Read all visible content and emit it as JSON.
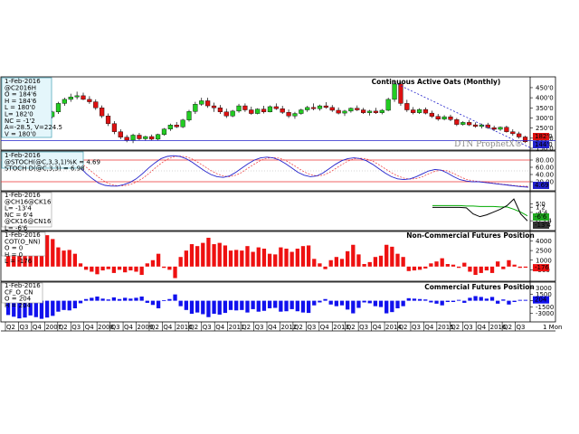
{
  "chart_data": {
    "type": "multi-panel",
    "watermark": "DTN ProphetX®",
    "x_axis": {
      "labels": [
        "Q2",
        "Q3",
        "Q4",
        "2007",
        "Q2",
        "Q3",
        "Q4",
        "2008",
        "Q3",
        "Q4",
        "2009",
        "Q2",
        "Q4",
        "2010",
        "Q2",
        "Q3",
        "Q4",
        "2011",
        "Q2",
        "Q3",
        "Q4",
        "2012",
        "Q2",
        "Q3",
        "Q4",
        "2013",
        "Q2",
        "Q3",
        "Q4",
        "2014",
        "Q2",
        "Q3",
        "Q4",
        "2015",
        "Q2",
        "Q3",
        "Q4",
        "2016",
        "Q2",
        "Q3"
      ],
      "end_label": "1 Mon"
    },
    "panels": [
      {
        "id": "price",
        "title": "Continuous Active Oats (Monthly)",
        "type": "candlestick",
        "info": [
          "1-Feb-2016",
          "@C2016H",
          "O = 184'6",
          "H = 184'6",
          "L = 180'0",
          "L= 182'0",
          "NC = -1'2",
          "A=-28.5, V=224.5",
          "V = 180'0"
        ],
        "y_ticks": [
          "450'0",
          "400'0",
          "350'0",
          "300'0",
          "250'0",
          "200'0",
          "150'0"
        ],
        "ylim": [
          150,
          490
        ],
        "last_labels": [
          "182'0",
          "144'0"
        ],
        "candles": [
          [
            270,
            285,
            258,
            282
          ],
          [
            282,
            295,
            270,
            276
          ],
          [
            276,
            290,
            268,
            285
          ],
          [
            285,
            300,
            275,
            290
          ],
          [
            290,
            305,
            280,
            286
          ],
          [
            286,
            296,
            276,
            292
          ],
          [
            292,
            310,
            284,
            306
          ],
          [
            306,
            335,
            298,
            330
          ],
          [
            330,
            380,
            320,
            372
          ],
          [
            372,
            400,
            360,
            392
          ],
          [
            392,
            420,
            380,
            404
          ],
          [
            404,
            430,
            392,
            410
          ],
          [
            410,
            425,
            388,
            392
          ],
          [
            392,
            408,
            370,
            380
          ],
          [
            380,
            392,
            340,
            350
          ],
          [
            350,
            362,
            300,
            310
          ],
          [
            310,
            322,
            260,
            272
          ],
          [
            272,
            284,
            220,
            232
          ],
          [
            232,
            244,
            195,
            205
          ],
          [
            205,
            216,
            180,
            190
          ],
          [
            190,
            222,
            176,
            215
          ],
          [
            215,
            226,
            190,
            197
          ],
          [
            197,
            212,
            188,
            208
          ],
          [
            208,
            218,
            190,
            195
          ],
          [
            195,
            222,
            190,
            218
          ],
          [
            218,
            250,
            212,
            245
          ],
          [
            245,
            272,
            236,
            265
          ],
          [
            265,
            280,
            250,
            256
          ],
          [
            256,
            296,
            250,
            290
          ],
          [
            290,
            340,
            282,
            332
          ],
          [
            332,
            380,
            320,
            368
          ],
          [
            368,
            400,
            360,
            385
          ],
          [
            385,
            400,
            350,
            360
          ],
          [
            360,
            376,
            330,
            350
          ],
          [
            350,
            364,
            320,
            330
          ],
          [
            330,
            346,
            300,
            310
          ],
          [
            310,
            340,
            304,
            334
          ],
          [
            334,
            370,
            326,
            360
          ],
          [
            360,
            372,
            330,
            340
          ],
          [
            340,
            356,
            316,
            322
          ],
          [
            322,
            348,
            318,
            344
          ],
          [
            344,
            360,
            322,
            330
          ],
          [
            330,
            362,
            328,
            356
          ],
          [
            356,
            372,
            340,
            346
          ],
          [
            346,
            360,
            320,
            328
          ],
          [
            328,
            342,
            300,
            310
          ],
          [
            310,
            330,
            296,
            322
          ],
          [
            322,
            346,
            316,
            340
          ],
          [
            340,
            360,
            330,
            352
          ],
          [
            352,
            372,
            338,
            346
          ],
          [
            346,
            366,
            336,
            360
          ],
          [
            360,
            378,
            346,
            352
          ],
          [
            352,
            364,
            330,
            338
          ],
          [
            338,
            352,
            318,
            324
          ],
          [
            324,
            340,
            310,
            334
          ],
          [
            334,
            352,
            326,
            348
          ],
          [
            348,
            362,
            334,
            340
          ],
          [
            340,
            350,
            320,
            326
          ],
          [
            326,
            340,
            312,
            334
          ],
          [
            334,
            350,
            320,
            326
          ],
          [
            326,
            344,
            318,
            338
          ],
          [
            338,
            400,
            334,
            392
          ],
          [
            392,
            486,
            380,
            468
          ],
          [
            468,
            478,
            360,
            372
          ],
          [
            372,
            390,
            330,
            340
          ],
          [
            340,
            354,
            318,
            326
          ],
          [
            326,
            348,
            320,
            342
          ],
          [
            342,
            352,
            318,
            324
          ],
          [
            324,
            336,
            300,
            308
          ],
          [
            308,
            320,
            286,
            294
          ],
          [
            294,
            314,
            288,
            306
          ],
          [
            306,
            316,
            284,
            292
          ],
          [
            292,
            300,
            260,
            268
          ],
          [
            268,
            284,
            262,
            278
          ],
          [
            278,
            290,
            260,
            266
          ],
          [
            266,
            278,
            252,
            258
          ],
          [
            258,
            272,
            248,
            266
          ],
          [
            266,
            276,
            246,
            252
          ],
          [
            252,
            262,
            236,
            244
          ],
          [
            244,
            258,
            236,
            254
          ],
          [
            254,
            262,
            228,
            232
          ],
          [
            232,
            244,
            212,
            222
          ],
          [
            222,
            232,
            198,
            206
          ],
          [
            206,
            212,
            176,
            182
          ]
        ],
        "support_line": 188,
        "trend_line": [
          [
            62,
            474
          ],
          [
            84,
            150
          ]
        ]
      },
      {
        "id": "stochastic",
        "info": [
          "1-Feb-2016",
          "@STOCH(@C,3,3,1)%K = 4.69",
          "STOCH D(@C,3,3) = 6.98"
        ],
        "y_ticks": [
          "80.00",
          "60.00",
          "40.00",
          "20.00"
        ],
        "ylim": [
          0,
          100
        ],
        "last_label": "4.69",
        "levels": [
          80,
          20
        ],
        "k": [
          62,
          66,
          72,
          80,
          86,
          90,
          92,
          94,
          94,
          92,
          88,
          76,
          60,
          42,
          28,
          16,
          10,
          8,
          8,
          12,
          18,
          28,
          42,
          58,
          72,
          84,
          90,
          92,
          90,
          84,
          74,
          62,
          50,
          40,
          34,
          32,
          36,
          46,
          58,
          70,
          80,
          86,
          88,
          86,
          80,
          70,
          58,
          46,
          38,
          34,
          36,
          44,
          56,
          68,
          78,
          84,
          86,
          84,
          78,
          68,
          56,
          44,
          34,
          28,
          26,
          28,
          34,
          42,
          50,
          54,
          52,
          44,
          34,
          26,
          22,
          20,
          20,
          18,
          16,
          14,
          12,
          10,
          8,
          6,
          5
        ],
        "d": [
          58,
          62,
          68,
          74,
          80,
          86,
          89,
          91,
          92,
          92,
          90,
          84,
          74,
          60,
          46,
          32,
          20,
          12,
          9,
          9,
          12,
          19,
          29,
          42,
          57,
          71,
          82,
          89,
          91,
          89,
          83,
          73,
          62,
          51,
          42,
          36,
          34,
          38,
          46,
          58,
          69,
          79,
          85,
          87,
          85,
          79,
          69,
          58,
          47,
          40,
          36,
          38,
          45,
          56,
          67,
          77,
          83,
          85,
          83,
          77,
          67,
          56,
          45,
          36,
          30,
          27,
          29,
          34,
          42,
          49,
          52,
          50,
          43,
          34,
          27,
          23,
          21,
          19,
          17,
          15,
          13,
          11,
          9,
          8,
          7
        ]
      },
      {
        "id": "spread",
        "info": [
          "1-Feb-2016",
          "@CH16@CK16",
          "L= -13'4",
          "NC = 6'4",
          "@CK16@CN16",
          "L= -6'6"
        ],
        "y_ticks": [
          "1'2",
          "5'0",
          "-4'4",
          "-13'4"
        ],
        "ylim": [
          -22,
          16
        ],
        "last_labels": [
          "-6'6",
          "-13'4"
        ],
        "series": [
          {
            "color": "#00aa00",
            "values": [
              3,
              3,
              3,
              3,
              3,
              2.5,
              2.5,
              2,
              2,
              2,
              1.5,
              1.5,
              -1,
              -4,
              -8
            ]
          },
          {
            "color": "#000000",
            "values": [
              1,
              1,
              1,
              1,
              1,
              0.5,
              -6,
              -9,
              -7,
              -4,
              -1,
              3,
              10,
              -6,
              -13.5
            ]
          }
        ]
      },
      {
        "id": "non-commercial",
        "title": "Non-Commercial Futures Position",
        "info": [
          "1-Feb-2016",
          "COT(O_NN)",
          "O = 0",
          "H = 0",
          "L = -176"
        ],
        "y_ticks": [
          "4000",
          "2500",
          "1000",
          "-500"
        ],
        "ylim": [
          -2000,
          5200
        ],
        "last_label": "-176",
        "values": [
          4200,
          5000,
          5000,
          5000,
          4500,
          4800,
          5000,
          4900,
          4300,
          3000,
          2500,
          2600,
          2000,
          500,
          -500,
          -800,
          -1200,
          -600,
          -400,
          -1000,
          -500,
          -900,
          -600,
          -800,
          -1300,
          500,
          1000,
          2000,
          -200,
          -500,
          -1800,
          1500,
          2500,
          3500,
          3200,
          3700,
          4500,
          3500,
          3700,
          3300,
          2500,
          2600,
          2500,
          3200,
          2300,
          3000,
          2800,
          2000,
          1900,
          3000,
          2800,
          2300,
          2800,
          3200,
          3300,
          1200,
          500,
          -400,
          1000,
          1500,
          1200,
          2400,
          3400,
          1900,
          400,
          700,
          1500,
          1700,
          3400,
          3100,
          2000,
          1500,
          -700,
          -600,
          -500,
          -300,
          500,
          800,
          1300,
          400,
          300,
          -200,
          600,
          -800,
          -1300,
          -1000,
          -600,
          -1000,
          800,
          -400,
          1000,
          300,
          -200,
          -176
        ]
      },
      {
        "id": "commercial",
        "title": "Commercial Futures Position",
        "info": [
          "1-Feb-2016",
          "CF_O_CN",
          "O = 204",
          "H = 204"
        ],
        "y_ticks": [
          "3000",
          "1500",
          "0",
          "-1500",
          "-3000"
        ],
        "ylim": [
          -4600,
          4000
        ],
        "last_label": "204",
        "values": [
          -3400,
          -3800,
          -4200,
          -4000,
          -3500,
          -3900,
          -4300,
          -4000,
          -3600,
          -2600,
          -2200,
          -2300,
          -1800,
          -600,
          400,
          700,
          1000,
          500,
          300,
          800,
          400,
          700,
          500,
          700,
          1000,
          -500,
          -1000,
          -1800,
          100,
          400,
          1500,
          -1300,
          -2200,
          -3100,
          -2800,
          -3200,
          -3900,
          -3100,
          -3300,
          -2900,
          -2200,
          -2300,
          -2200,
          -2800,
          -2000,
          -2600,
          -2400,
          -1800,
          -1700,
          -2600,
          -2500,
          -2000,
          -2500,
          -2800,
          -2900,
          -1100,
          -400,
          400,
          -900,
          -1300,
          -1100,
          -2100,
          -3000,
          -1700,
          -400,
          -600,
          -1300,
          -1500,
          -3000,
          -2700,
          -1800,
          -1300,
          600,
          500,
          400,
          300,
          -400,
          -700,
          -1100,
          -300,
          -300,
          200,
          -500,
          700,
          1100,
          900,
          500,
          900,
          -700,
          300,
          -900,
          -300,
          200,
          204
        ]
      }
    ]
  }
}
